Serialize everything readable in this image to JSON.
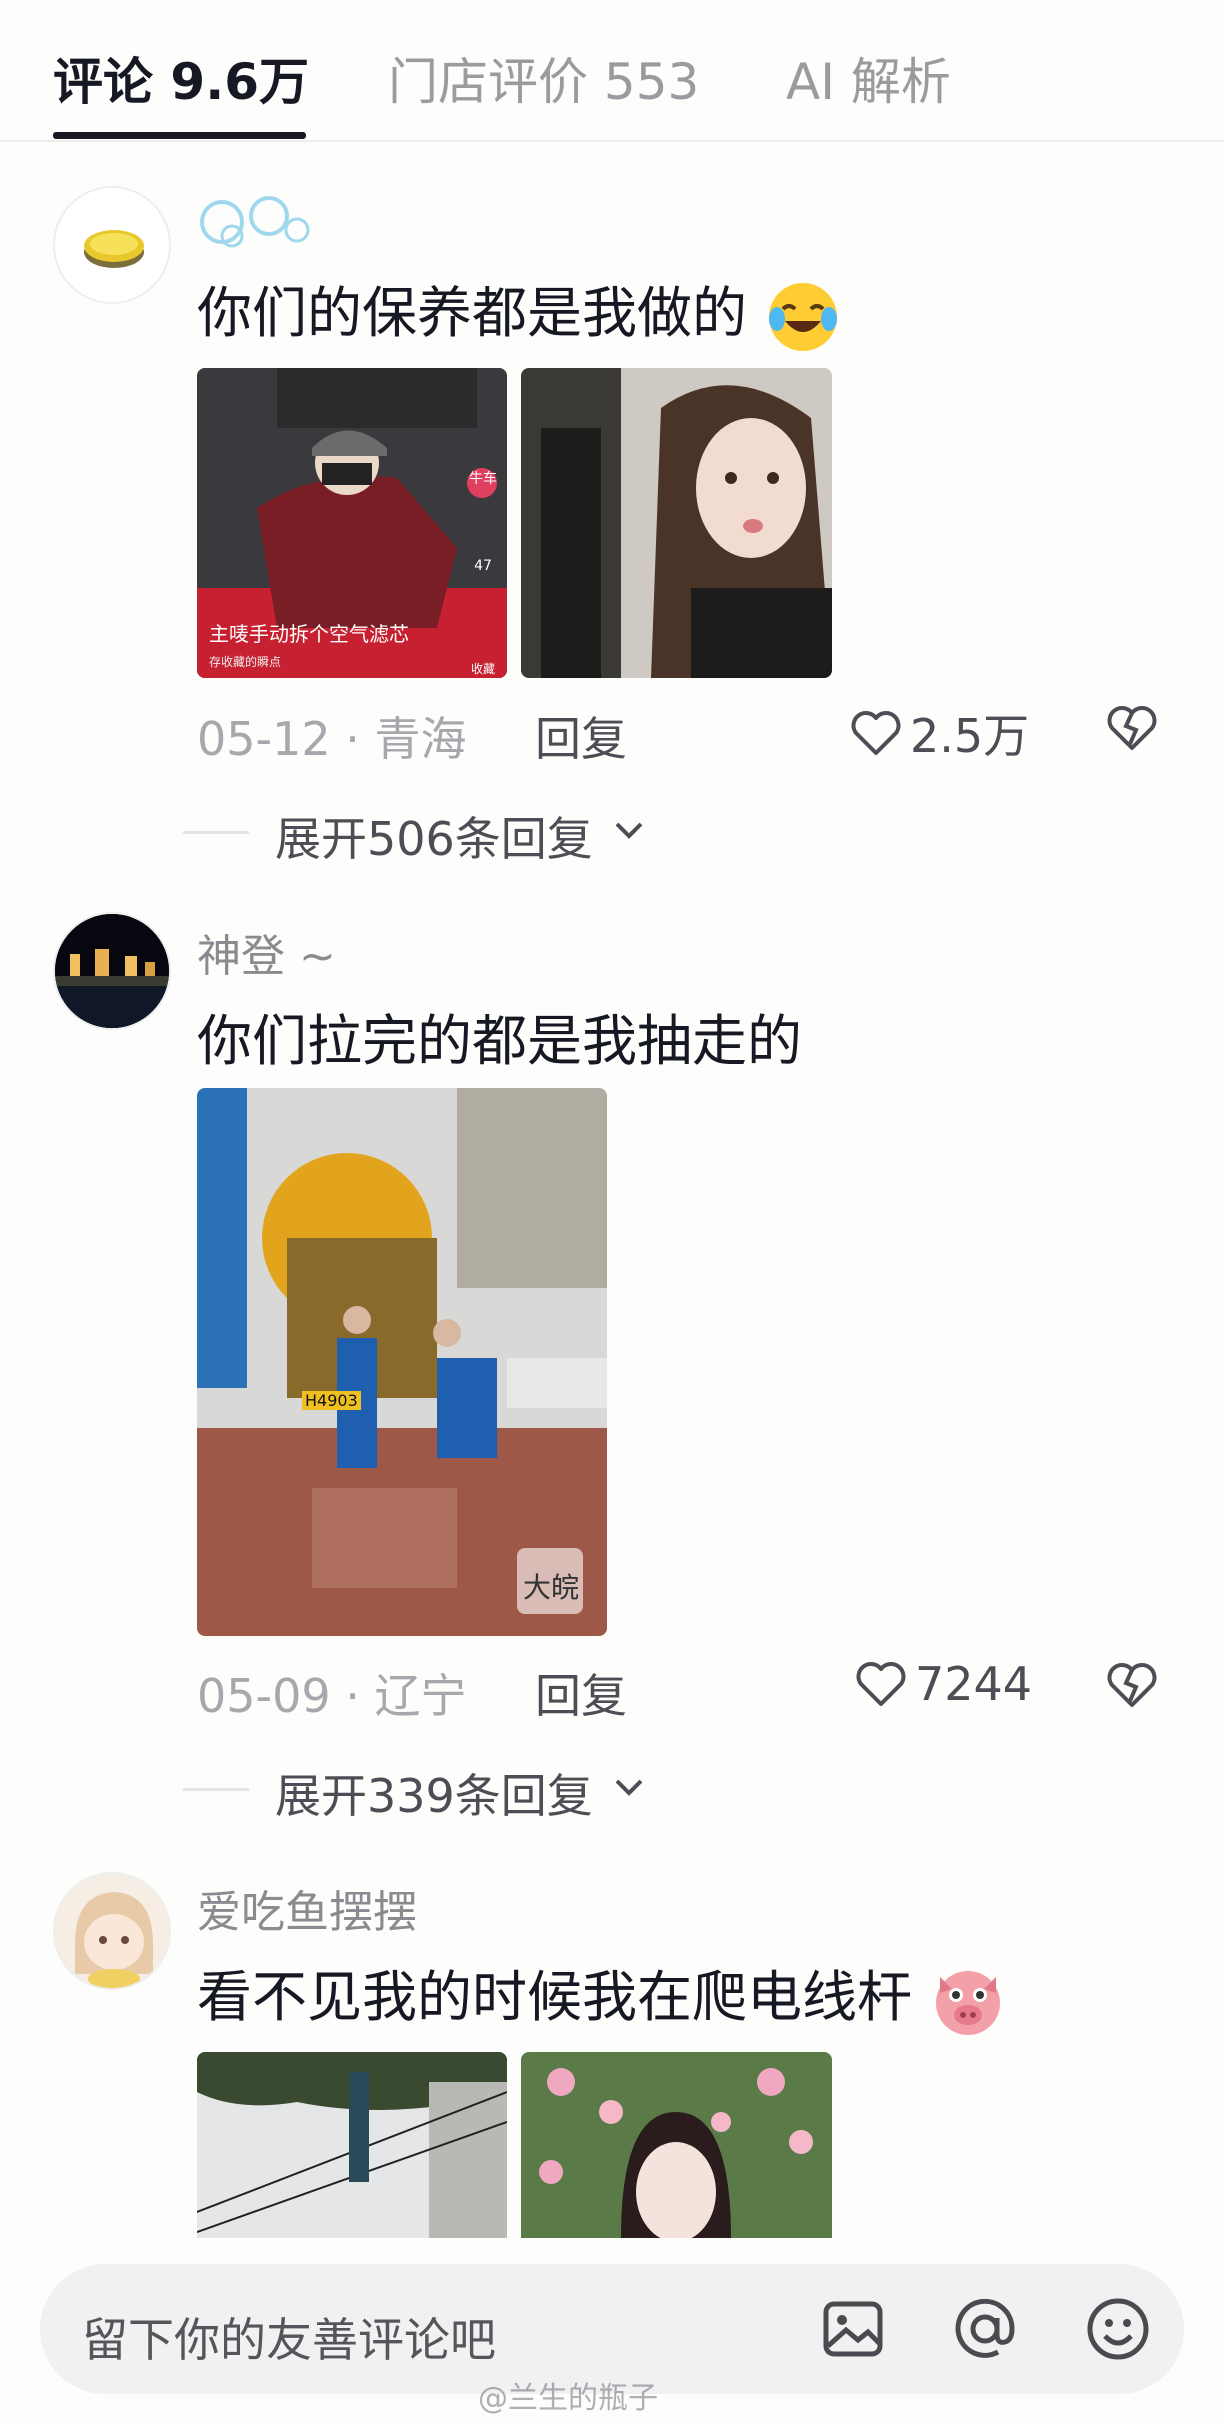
{
  "tabs": [
    {
      "label": "评论 9.6万",
      "active": true
    },
    {
      "label": "门店评价 553",
      "active": false
    },
    {
      "label": "AI 解析",
      "active": false
    }
  ],
  "comments": [
    {
      "username": "",
      "username_icon": "bubbles-icon",
      "text": "你们的保养都是我做的",
      "emoji": "crying-laughing-emoji",
      "thumb1_caption": "主唛手动拆个空气滤芯",
      "thumb1_like_count": "47",
      "thumb1_save_label": "收藏",
      "thumb1_footer": "存收藏的瞬点",
      "thumb1_user_tag": "牛车",
      "date_location": "05-12 · 青海",
      "reply_label": "回复",
      "likes": "2.5万",
      "expand": "展开506条回复"
    },
    {
      "username": "神登 ~",
      "text": "你们拉完的都是我抽走的",
      "thumb_truck_plate": "H4903",
      "thumb_watermark": "大皖",
      "date_location": "05-09 · 辽宁",
      "reply_label": "回复",
      "likes": "7244",
      "expand": "展开339条回复"
    },
    {
      "username": "爱吃鱼摆摆",
      "text": "看不见我的时候我在爬电线杆",
      "emoji": "pig-face-emoji"
    }
  ],
  "input": {
    "placeholder": "留下你的友善评论吧",
    "icons": [
      "image-icon",
      "at-icon",
      "emoji-icon"
    ]
  },
  "watermark": "@兰生的瓶子",
  "colors": {
    "primary_text": "#161823",
    "secondary_text": "#8a8b91",
    "meta_text": "#a7a8ad",
    "background": "#fdfdfb"
  }
}
